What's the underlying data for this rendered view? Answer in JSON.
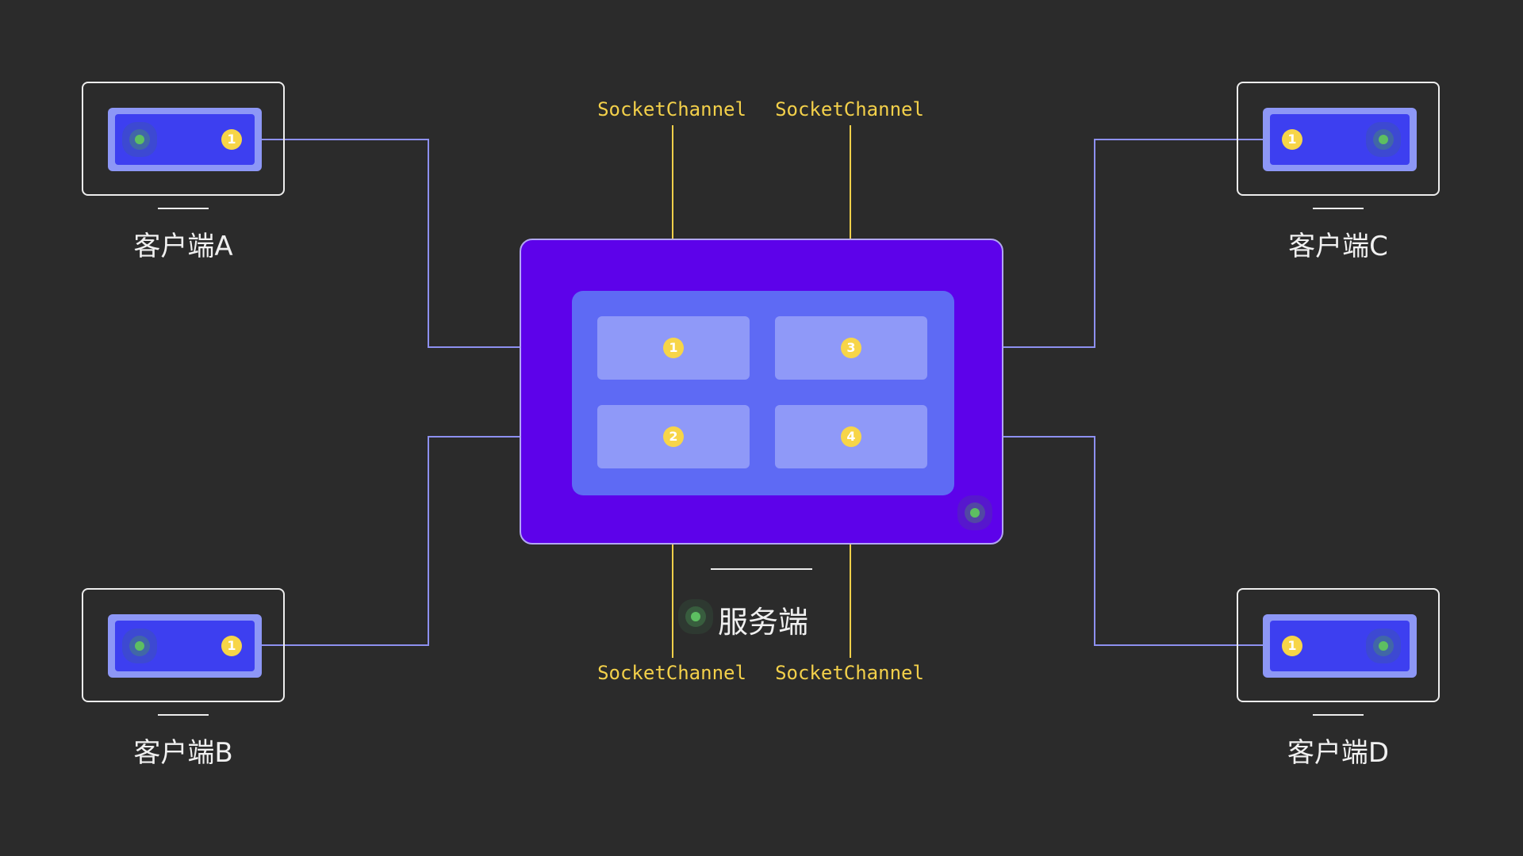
{
  "diagram": {
    "server": {
      "label": "服务端"
    },
    "channels": [
      {
        "id": "1",
        "caption": "SocketChannel"
      },
      {
        "id": "2",
        "caption": "SocketChannel"
      },
      {
        "id": "3",
        "caption": "SocketChannel"
      },
      {
        "id": "4",
        "caption": "SocketChannel"
      }
    ],
    "clients": [
      {
        "label": "客户端A",
        "badge": "1"
      },
      {
        "label": "客户端B",
        "badge": "1"
      },
      {
        "label": "客户端C",
        "badge": "1"
      },
      {
        "label": "客户端D",
        "badge": "1"
      }
    ],
    "colors": {
      "background": "#2b2b2b",
      "server": "#5d02ea",
      "panel": "#5e6af4",
      "channel": "#8f99f8",
      "accent_yellow": "#f3d04a",
      "connector": "#8d90f0",
      "status_green": "#5dbf61"
    }
  }
}
